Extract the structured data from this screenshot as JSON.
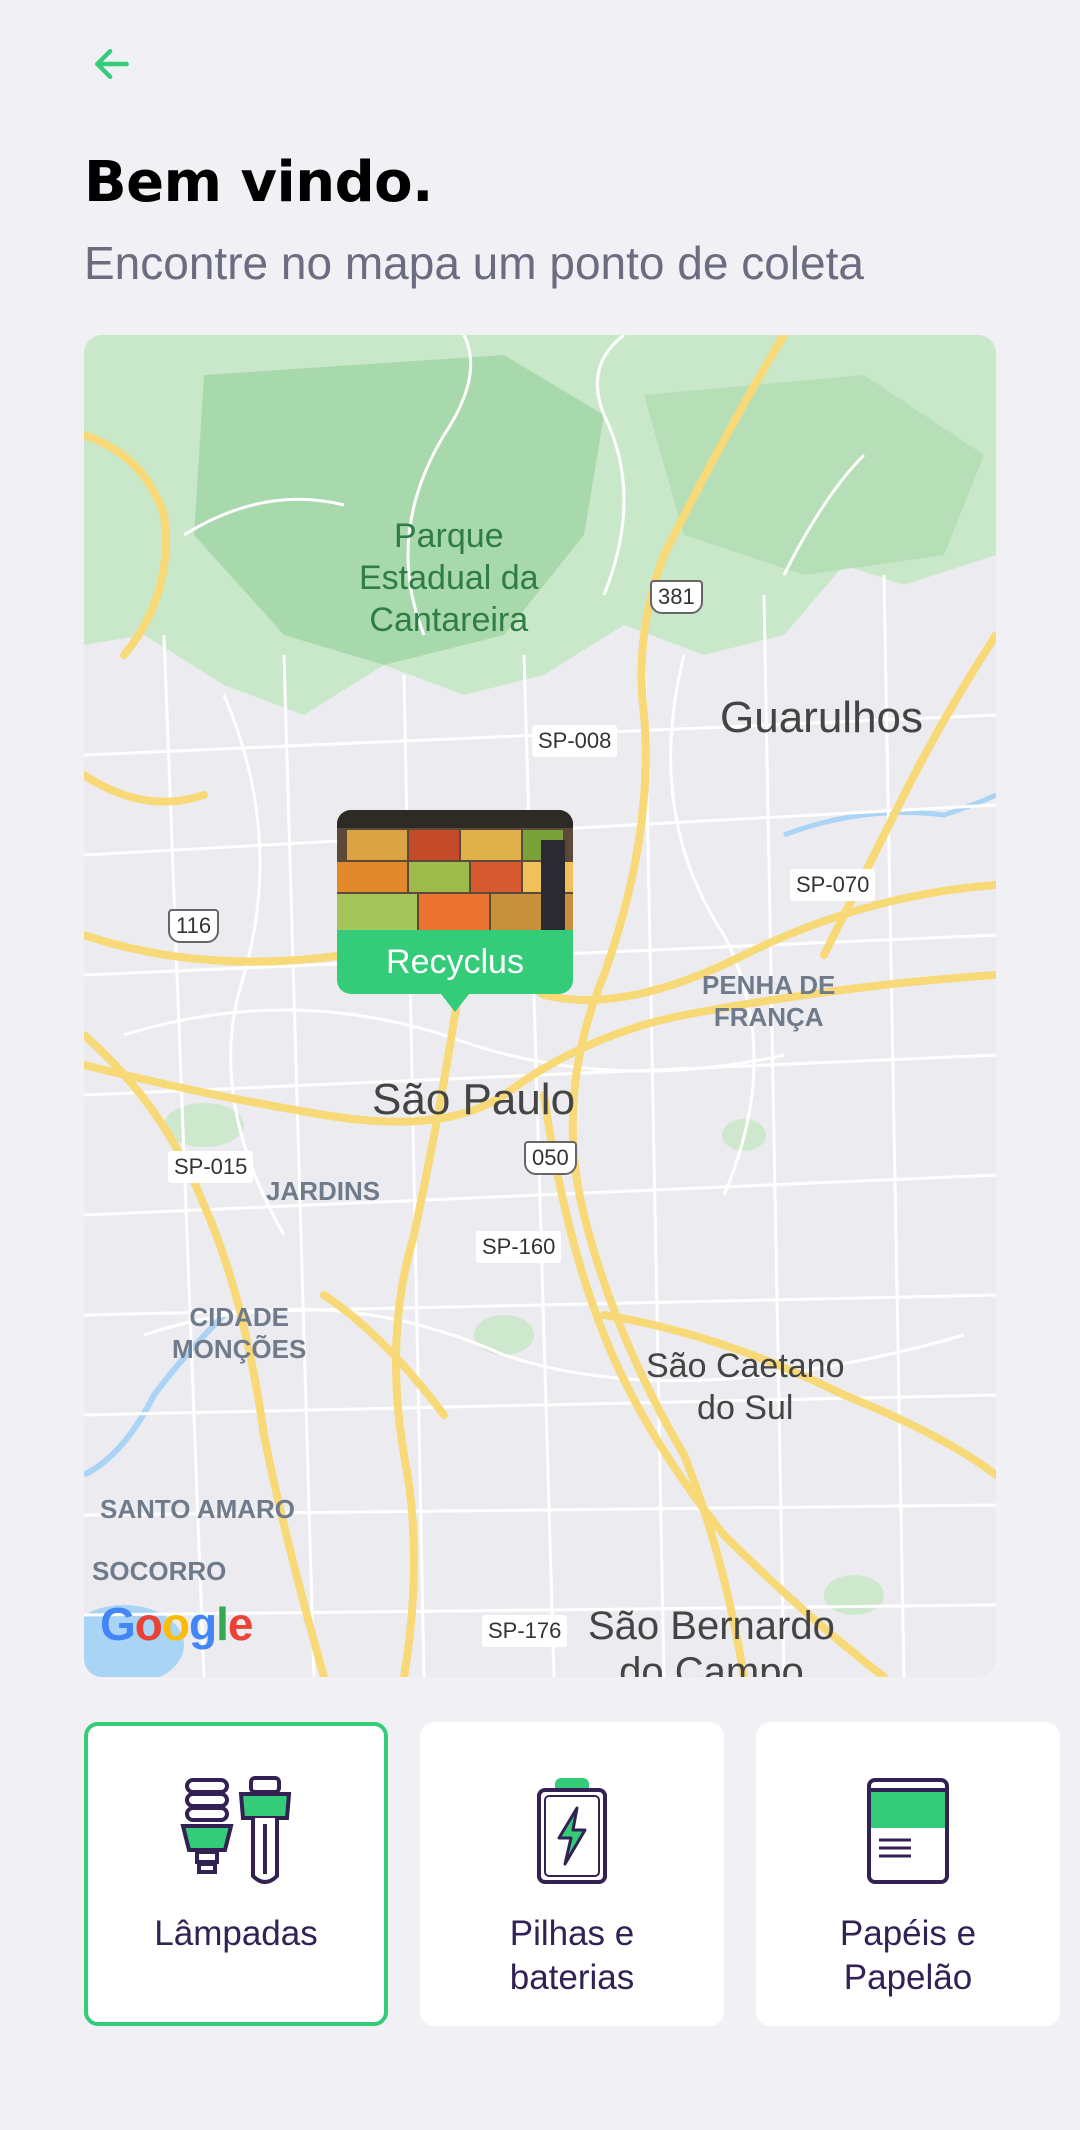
{
  "header": {
    "title": "Bem vindo.",
    "subtitle": "Encontre no mapa um ponto de coleta"
  },
  "map": {
    "park_label": [
      "Parque",
      "Estadual da",
      "Cantareira"
    ],
    "cities": [
      "Guarulhos",
      "São Paulo",
      "São Caetano",
      "do Sul",
      "São Bernardo",
      "do Campo"
    ],
    "districts": [
      "PENHA DE",
      "FRANÇA",
      "JARDINS",
      "CIDADE",
      "MONÇÕES",
      "SANTO AMARO",
      "SOCORRO"
    ],
    "roads": [
      "SP-008",
      "SP-070",
      "SP-015",
      "SP-160",
      "SP-176"
    ],
    "shields": [
      "381",
      "116",
      "050"
    ],
    "attribution": "Google",
    "marker": {
      "name": "Recyclus"
    }
  },
  "items": [
    {
      "label_line1": "Lâmpadas",
      "label_line2": "",
      "selected": true,
      "icon": "lamps-icon"
    },
    {
      "label_line1": "Pilhas e",
      "label_line2": "baterias",
      "selected": false,
      "icon": "battery-icon"
    },
    {
      "label_line1": "Papéis e",
      "label_line2": "Papelão",
      "selected": false,
      "icon": "paper-icon"
    }
  ],
  "colors": {
    "accent": "#34cb79",
    "title": "#000000",
    "subtitle": "#6c6c80",
    "item_text": "#322153",
    "background": "#f0f0f5"
  }
}
